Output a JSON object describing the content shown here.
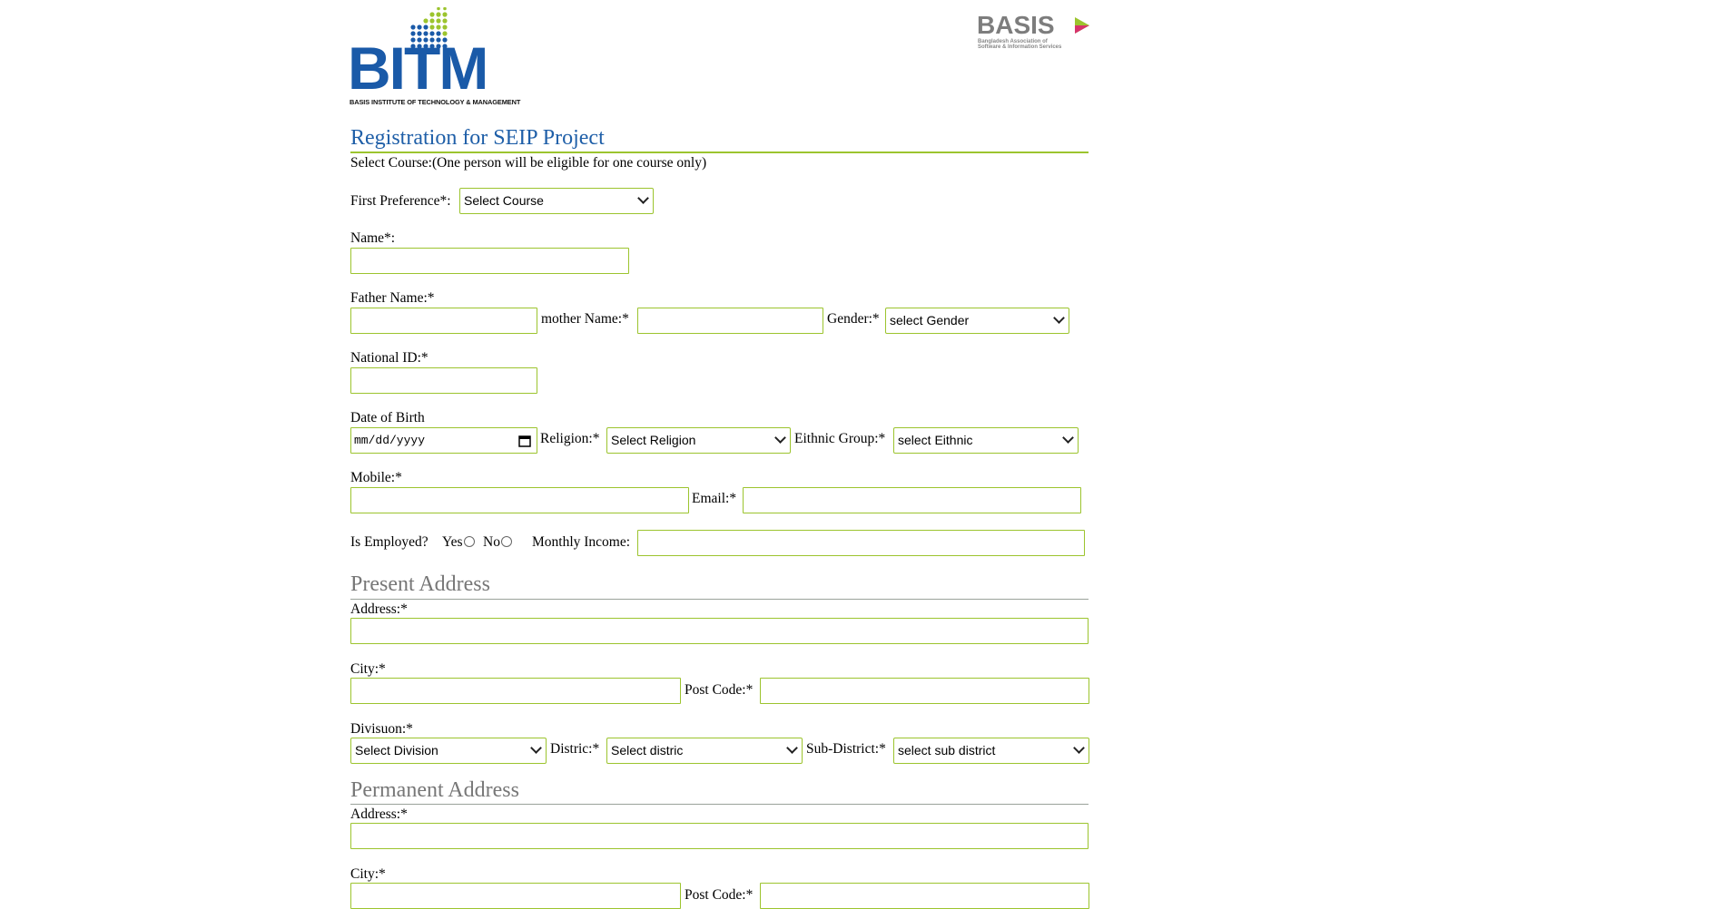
{
  "logo": {
    "text": "BITM",
    "subtitle": "BASIS INSTITUTE OF TECHNOLOGY & MANAGEMENT",
    "colors": {
      "blue": "#1a5aa8",
      "green": "#9cc42e"
    }
  },
  "partner_logo": {
    "text": "BASIS",
    "subtitle_line1": "Bangladesh Association of",
    "subtitle_line2": "Software & Information Services"
  },
  "form": {
    "title": "Registration for SEIP Project",
    "course_note": "Select Course:(One person will be eligible for one course only)",
    "first_preference_label": "First Preference*:",
    "first_preference_value": "Select Course",
    "name_label": "Name*:",
    "father_label": "Father Name:*",
    "mother_label": "mother Name:*",
    "gender_label": "Gender:*",
    "gender_value": "select Gender",
    "nid_label": "National ID:*",
    "dob_label": "Date of Birth",
    "dob_placeholder": "mm/dd/yyyy",
    "religion_label": "Religion:*",
    "religion_value": "Select Religion",
    "ethnic_label": "Eithnic Group:*",
    "ethnic_value": "select Eithnic",
    "mobile_label": "Mobile:*",
    "email_label": "Email:*",
    "employed_label": "Is Employed?",
    "yes_label": "Yes",
    "no_label": "No",
    "income_label": "Monthly Income:"
  },
  "present": {
    "heading": "Present Address",
    "address_label": "Address:*",
    "city_label": "City:*",
    "postcode_label": "Post Code:*",
    "division_label": "Divisuon:*",
    "division_value": "Select Division",
    "district_label": "Distric:*",
    "district_value": "Select distric",
    "subdistrict_label": "Sub-District:*",
    "subdistrict_value": "select sub district"
  },
  "permanent": {
    "heading": "Permanent Address",
    "address_label": "Address:*",
    "city_label": "City:*",
    "postcode_label": "Post Code:*"
  }
}
